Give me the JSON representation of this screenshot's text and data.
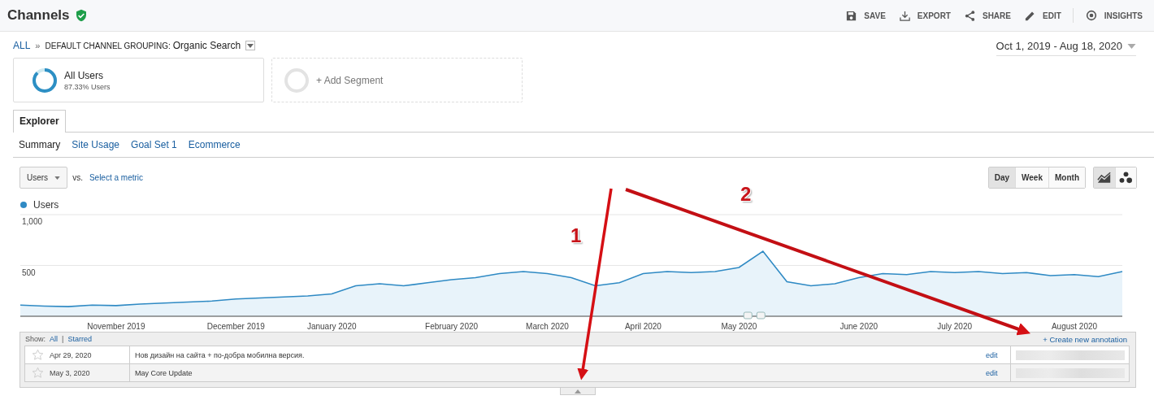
{
  "header": {
    "title": "Channels",
    "actions": [
      {
        "kind": "save",
        "label": "SAVE"
      },
      {
        "kind": "export",
        "label": "EXPORT"
      },
      {
        "kind": "share",
        "label": "SHARE"
      },
      {
        "kind": "edit",
        "label": "EDIT"
      },
      {
        "kind": "insights",
        "label": "INSIGHTS"
      }
    ]
  },
  "breadcrumb": {
    "root": "ALL",
    "separator": "»",
    "label": "DEFAULT CHANNEL GROUPING:",
    "value": "Organic Search"
  },
  "segments": {
    "items": [
      {
        "name": "All Users",
        "detail": "87.33% Users",
        "level": 0.8733
      }
    ],
    "add": "+ Add Segment"
  },
  "date_range": "Oct 1, 2019 - Aug 18, 2020",
  "tabs": [
    {
      "label": "Explorer",
      "selected": true
    }
  ],
  "subtabs": [
    {
      "label": "Summary",
      "selected": true
    },
    {
      "label": "Site Usage",
      "selected": false
    },
    {
      "label": "Goal Set 1",
      "selected": false
    },
    {
      "label": "Ecommerce",
      "selected": false
    }
  ],
  "metric": {
    "value": "Users",
    "vs": "vs.",
    "compare": "Select a metric"
  },
  "granularity": [
    {
      "label": "Day",
      "selected": true
    },
    {
      "label": "Week",
      "selected": false
    },
    {
      "label": "Month",
      "selected": false
    }
  ],
  "chart_types": [
    {
      "kind": "line",
      "selected": true
    },
    {
      "kind": "motion",
      "selected": false
    }
  ],
  "chart_data": {
    "type": "area",
    "ylim": [
      0,
      1000
    ],
    "yticks": [
      {
        "value": 500,
        "label": "500"
      },
      {
        "value": 1000,
        "label": "1,000"
      }
    ],
    "categories": [
      null,
      null,
      null,
      null,
      "November 2019",
      null,
      null,
      null,
      null,
      "December 2019",
      null,
      null,
      null,
      "January 2020",
      null,
      null,
      null,
      null,
      "February 2020",
      null,
      null,
      null,
      "March 2020",
      null,
      null,
      null,
      "April 2020",
      null,
      null,
      null,
      "May 2020",
      null,
      null,
      null,
      null,
      "June 2020",
      null,
      null,
      null,
      "July 2020",
      null,
      null,
      null,
      null,
      "August 2020",
      null,
      null
    ],
    "series": [
      {
        "name": "Users",
        "color": "#2f8ac4",
        "values": [
          110,
          100,
          95,
          110,
          105,
          120,
          130,
          140,
          150,
          170,
          180,
          190,
          200,
          220,
          300,
          320,
          300,
          330,
          360,
          380,
          420,
          440,
          420,
          380,
          300,
          330,
          420,
          440,
          430,
          440,
          480,
          640,
          340,
          300,
          320,
          380,
          420,
          410,
          440,
          430,
          440,
          420,
          430,
          400,
          410,
          390,
          440
        ]
      }
    ]
  },
  "annotations": {
    "show_label": "Show:",
    "filters": [
      "All",
      "Starred"
    ],
    "divider": "|",
    "create": "+ Create new annotation",
    "rows": [
      {
        "date": "Apr 29, 2020",
        "text": "Нов дизайн на сайта + по-добра мобилна версия.",
        "edit": "edit"
      },
      {
        "date": "May 3, 2020",
        "text": "May Core Update",
        "edit": "edit"
      }
    ]
  },
  "overlay": {
    "numbers": [
      "1",
      "2"
    ]
  }
}
